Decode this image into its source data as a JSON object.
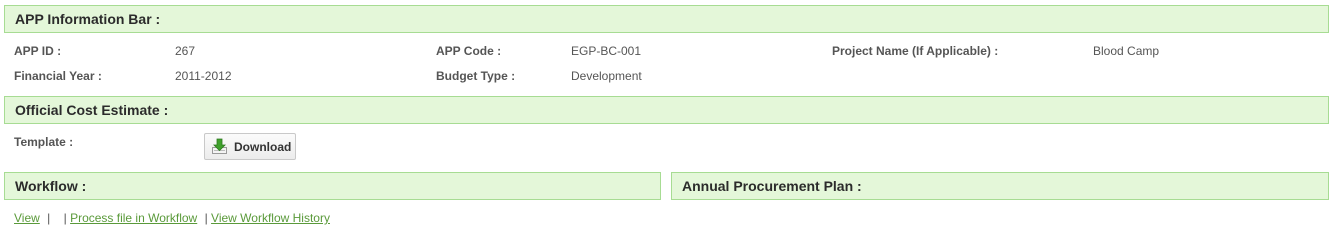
{
  "app_info": {
    "title": "APP Information Bar :",
    "app_id_label": "APP ID :",
    "app_id_value": "267",
    "app_code_label": "APP Code :",
    "app_code_value": "EGP-BC-001",
    "project_name_label": "Project Name (If Applicable) :",
    "project_name_value": "Blood Camp",
    "financial_year_label": "Financial Year :",
    "financial_year_value": "2011-2012",
    "budget_type_label": "Budget Type :",
    "budget_type_value": "Development"
  },
  "cost_estimate": {
    "title": "Official Cost Estimate :",
    "template_label": "Template :",
    "download_label": "Download",
    "download_icon": "download-icon"
  },
  "workflow": {
    "title": "Workflow :",
    "links": {
      "view": "View",
      "process": "Process file in Workflow",
      "history": "View Workflow History"
    },
    "separator": "|"
  },
  "annual_plan": {
    "title": "Annual Procurement Plan :"
  },
  "colors": {
    "bar_bg": "#e4f7d9",
    "bar_border": "#a7dc93",
    "link": "#5a9a3a"
  }
}
